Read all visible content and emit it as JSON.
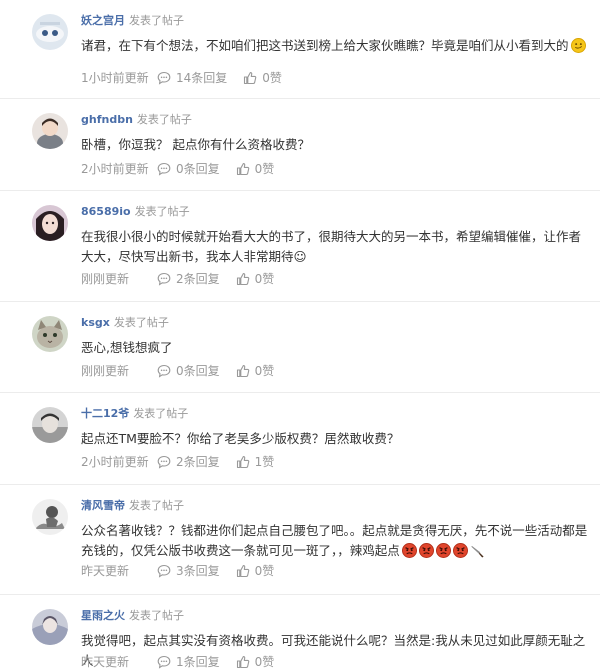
{
  "labels": {
    "posted": "发表了帖子"
  },
  "posts": [
    {
      "user": "妖之宫月",
      "content": "诸君，在下有个想法，不如咱们把这书送到榜上给大家伙瞧瞧？毕竟是咱们从小看到大的",
      "time": "1小时前更新",
      "replies": "14条回复",
      "likes": "0赞"
    },
    {
      "user": "ghfndbn",
      "content": "卧槽，你逗我？ 起点你有什么资格收费？",
      "time": "2小时前更新",
      "replies": "0条回复",
      "likes": "0赞"
    },
    {
      "user": "86589io",
      "content": "在我很小很小的时候就开始看大大的书了，很期待大大的另一本书，希望编辑催催，让作者大大，尽快写出新书，我本人非常期待☺",
      "time": "刚刚更新",
      "replies": "2条回复",
      "likes": "0赞"
    },
    {
      "user": "ksgx",
      "content": "恶心,想钱想疯了",
      "time": "刚刚更新",
      "replies": "0条回复",
      "likes": "0赞"
    },
    {
      "user": "十二12爷",
      "content": "起点还TM要脸不？你给了老吴多少版权费？居然敢收费？",
      "time": "2小时前更新",
      "replies": "2条回复",
      "likes": "1赞"
    },
    {
      "user": "清风雪帝",
      "content": "公众名著收钱？？钱都进你们起点自己腰包了吧。。起点就是贪得无厌，先不说一些活动都是充钱的，仅凭公版书收费这一条就可见一斑了，，辣鸡起点",
      "time": "昨天更新",
      "replies": "3条回复",
      "likes": "0赞"
    },
    {
      "user": "星雨之火",
      "content": "我觉得吧，起点其实没有资格收费。可我还能说什么呢？当然是:我从未见过如此厚颜无耻之人",
      "time": "昨天更新",
      "replies": "1条回复",
      "likes": "0赞"
    }
  ],
  "colors": {
    "username": "#4a6ea9",
    "meta": "#999999",
    "text": "#333333",
    "divider": "#ececec"
  },
  "icons": {
    "reply": "comment-bubble-icon",
    "like": "thumbs-up-icon",
    "emoji": "smiley-emoji-icon",
    "angry": "angry-face-emoji-icon",
    "knife": "knife-emoji-icon"
  }
}
